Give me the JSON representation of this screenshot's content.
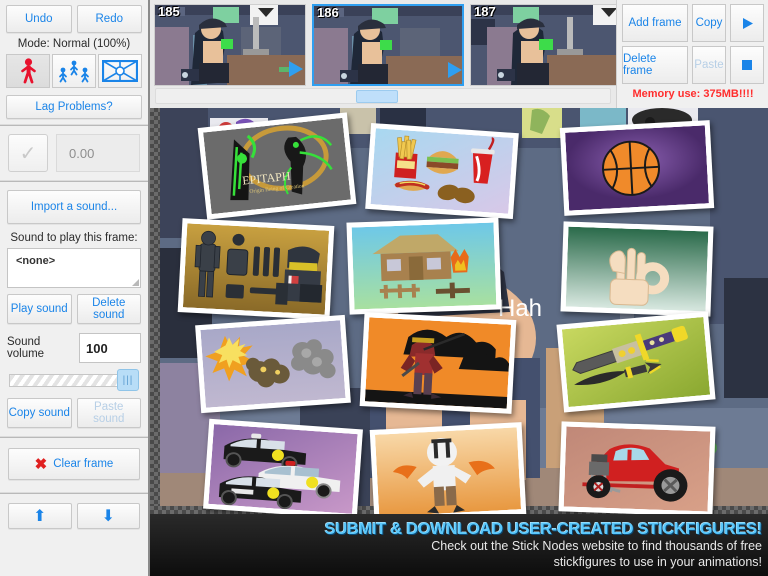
{
  "sidebar": {
    "undo_label": "Undo",
    "redo_label": "Redo",
    "mode_label": "Mode: Normal (100%)",
    "mode_icons": [
      {
        "name": "single-stickfigure-icon",
        "selected": true
      },
      {
        "name": "multiple-stickfigures-icon",
        "selected": false
      },
      {
        "name": "frame-grid-icon",
        "selected": false
      }
    ],
    "lag_label": "Lag Problems?",
    "tween_checkbox_checked": true,
    "tween_value": "0.00",
    "import_sound_label": "Import a sound...",
    "sound_frame_label": "Sound to play this frame:",
    "sound_value": "<none>",
    "play_sound_label": "Play sound",
    "delete_sound_label": "Delete sound",
    "volume_label": "Sound volume",
    "volume_value": "100",
    "copy_sound_label": "Copy sound",
    "paste_sound_label": "Paste sound",
    "clear_frame_label": "Clear frame",
    "move_up_icon": "arrow-up-icon",
    "move_down_icon": "arrow-down-icon"
  },
  "frames": {
    "items": [
      {
        "number": "185",
        "selected": false
      },
      {
        "number": "186",
        "selected": true
      },
      {
        "number": "187",
        "selected": false
      }
    ],
    "scroll_position_percent": 44
  },
  "frame_controls": {
    "add_frame_label": "Add frame",
    "copy_label": "Copy",
    "play_icon": "play-icon",
    "delete_frame_label": "Delete frame",
    "paste_label": "Paste",
    "paste_disabled": true,
    "stop_icon": "stop-icon",
    "memory_label": "Memory use: 375MB!!!!",
    "memory_color": "#ff2d2d"
  },
  "canvas": {
    "background_text": "Hah",
    "cards": [
      {
        "name": "epitaph-artwork-card",
        "title": "EPITAPH",
        "subtitle": "Origin Being of Creation"
      },
      {
        "name": "fastfood-card",
        "title": ""
      },
      {
        "name": "basketball-card",
        "title": ""
      },
      {
        "name": "military-gear-card",
        "title": ""
      },
      {
        "name": "minecraft-house-card",
        "title": ""
      },
      {
        "name": "ok-hand-card",
        "title": ""
      },
      {
        "name": "explosions-card",
        "title": ""
      },
      {
        "name": "samurai-card",
        "title": ""
      },
      {
        "name": "swords-card",
        "title": ""
      },
      {
        "name": "police-cars-card",
        "title": ""
      },
      {
        "name": "character-card",
        "title": ""
      },
      {
        "name": "hotrod-car-card",
        "title": ""
      }
    ]
  },
  "banner": {
    "headline": "SUBMIT & DOWNLOAD USER-CREATED STICKFIGURES!",
    "line1": "Check out the Stick Nodes website to find thousands of free",
    "line2": "stickfigures to use in your animations!",
    "headline_color": "#5bc8fb"
  }
}
